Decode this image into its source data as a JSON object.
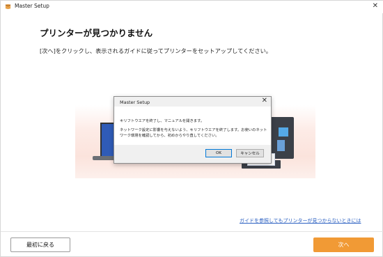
{
  "window": {
    "title": "Master Setup",
    "close_symbol": "✕",
    "icon": "app-icon"
  },
  "main": {
    "heading": "プリンターが見つかりません",
    "instruction": "[次へ]をクリックし、表示されるガイドに従ってプリンターをセットアップしてください。",
    "guide_link": "ガイドを参照してもプリンターが見つからないときには"
  },
  "dialog": {
    "title": "Master Setup",
    "close_symbol": "✕",
    "message_line1": "キリフトウエアを終了し、マニュアルを開きます。",
    "message_line2": "ネットワーク設定に影響を与えないよう、キリフトウエアを終了します。お使いのネットワーク環境を確認してから、初めからやり直してください。",
    "ok_label": "OK",
    "cancel_label": "キャンセル"
  },
  "footer": {
    "back_label": "最初に戻る",
    "next_label": "次へ"
  },
  "colors": {
    "accent": "#f19a35",
    "link": "#2a5fc1",
    "printer_panel": "#55a9e6"
  }
}
